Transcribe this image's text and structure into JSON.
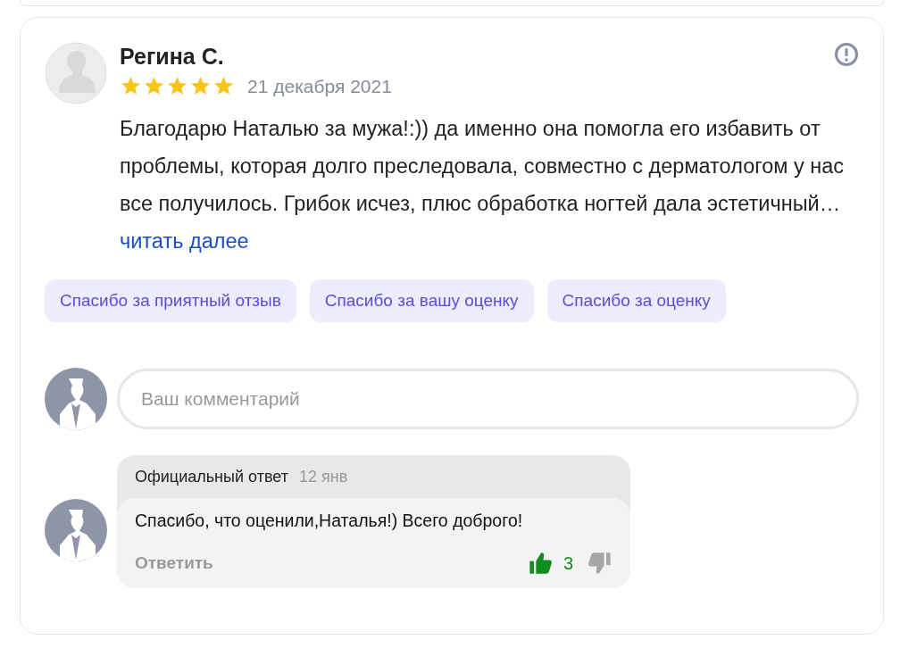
{
  "review": {
    "author": "Регина С.",
    "stars": 5,
    "date": "21 декабря 2021",
    "text": "Благодарю Наталью за мужа!:)) да именно она помогла его избавить от проблемы, которая долго преследовала, совместно с дерматологом у нас все получилось. Грибок исчез, плюс обработка ногтей дала эстетичный…",
    "more_link": "читать далее"
  },
  "quick_replies": [
    "Спасибо за приятный отзыв",
    "Спасибо за вашу оценку",
    "Спасибо за оценку"
  ],
  "comment_field": {
    "placeholder": "Ваш комментарий"
  },
  "official_reply": {
    "label": "Официальный ответ",
    "date": "12 янв",
    "text": "Спасибо, что оценили,Наталья!) Всего доброго!",
    "reply_button": "Ответить",
    "likes": "3",
    "liked": true,
    "disliked": false
  }
}
